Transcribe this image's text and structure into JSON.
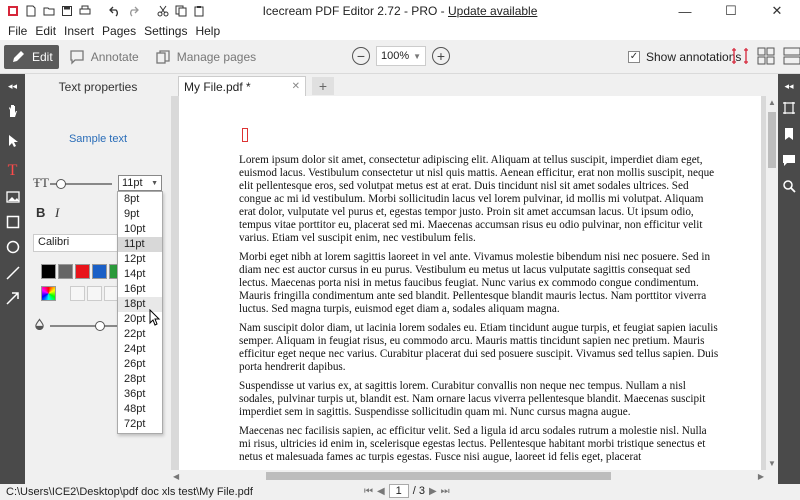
{
  "app": {
    "title_prefix": "Icecream PDF Editor 2.72 - PRO - ",
    "update_link": "Update available"
  },
  "menu": [
    "File",
    "Edit",
    "Insert",
    "Pages",
    "Settings",
    "Help"
  ],
  "toolbar": {
    "edit": "Edit",
    "annotate": "Annotate",
    "manage_pages": "Manage pages",
    "zoom_value": "100%",
    "show_annotations": "Show annotations",
    "show_annotations_checked": true
  },
  "panel": {
    "title": "Text properties",
    "sample": "Sample text",
    "font_size": "11pt",
    "font_name": "Calibri",
    "bold": "B",
    "italic": "I",
    "colors": [
      "#000000",
      "#666666",
      "#e8141b",
      "#1a5fc6",
      "#2b9a3b"
    ]
  },
  "font_sizes": [
    "8pt",
    "9pt",
    "10pt",
    "11pt",
    "12pt",
    "14pt",
    "16pt",
    "18pt",
    "20pt",
    "22pt",
    "24pt",
    "26pt",
    "28pt",
    "36pt",
    "48pt",
    "72pt"
  ],
  "font_sizes_selected": "11pt",
  "font_sizes_hovered": "18pt",
  "tab": {
    "name": "My File.pdf *"
  },
  "document": {
    "paragraphs": [
      "Lorem ipsum dolor sit amet, consectetur adipiscing elit. Aliquam at tellus suscipit, imperdiet diam eget, euismod lacus. Vestibulum consectetur ut nisl quis mattis. Aenean efficitur, erat non mollis suscipit, neque elit pellentesque eros, sed volutpat metus est at erat. Duis tincidunt nisl sit amet sodales ultrices. Sed congue ac mi id vestibulum. Morbi sollicitudin lacus vel lorem pulvinar, id mollis mi volutpat. Aliquam erat dolor, vulputate vel purus et, egestas tempor justo. Proin sit amet accumsan lacus. Ut ipsum odio, tempus vitae porttitor eu, placerat sed mi. Maecenas accumsan risus eu odio pulvinar, non efficitur velit varius. Etiam vel suscipit enim, nec vestibulum felis.",
      "Morbi eget nibh at lorem sagittis laoreet in vel ante. Vivamus molestie bibendum nisi nec posuere. Sed in diam nec est auctor cursus in eu purus. Vestibulum eu metus ut lacus vulputate sagittis consequat sed lectus. Maecenas porta nisi in metus faucibus feugiat. Nunc varius ex commodo congue condimentum. Mauris fringilla condimentum ante sed blandit. Pellentesque blandit mauris lectus. Nam porttitor viverra luctus. Sed magna turpis, euismod eget diam a, sodales aliquam magna.",
      "Nam suscipit dolor diam, ut lacinia lorem sodales eu. Etiam tincidunt augue turpis, et feugiat sapien iaculis semper. Aliquam in feugiat risus, eu commodo arcu. Mauris mattis tincidunt sapien nec pretium. Mauris efficitur eget neque nec varius. Curabitur placerat dui sed posuere suscipit. Vivamus sed tellus sapien. Duis porta hendrerit dapibus.",
      "Suspendisse ut varius ex, at sagittis lorem. Curabitur convallis non neque nec tempus. Nullam a nisl sodales, pulvinar turpis ut, blandit est. Nam ornare lacus viverra pellentesque blandit. Maecenas suscipit imperdiet sem in sagittis. Suspendisse sollicitudin quam mi. Nunc cursus magna augue.",
      "Maecenas nec facilisis sapien, ac efficitur velit. Sed a ligula id arcu sodales rutrum a molestie nisl. Nulla mi risus, ultricies id enim in, scelerisque egestas lectus. Pellentesque habitant morbi tristique senectus et netus et malesuada fames ac turpis egestas. Fusce nisi augue, laoreet id felis eget, placerat"
    ]
  },
  "status": {
    "path": "C:\\Users\\ICE2\\Desktop\\pdf doc xls test\\My File.pdf",
    "page_current": "1",
    "page_total": "/ 3"
  }
}
